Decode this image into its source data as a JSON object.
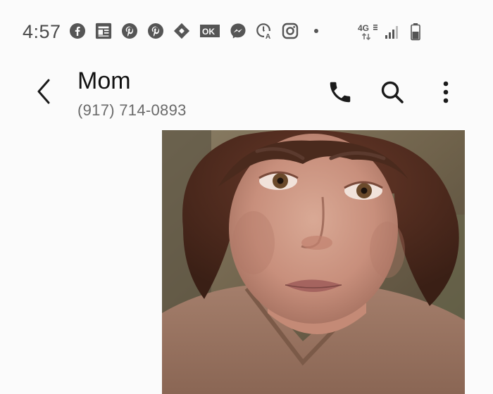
{
  "status_bar": {
    "time": "4:57",
    "network": "4G",
    "notification_icons": [
      "facebook-icon",
      "news-icon",
      "pinterest-icon",
      "pinterest-icon",
      "photos-icon",
      "ok-icon",
      "messenger-icon",
      "clock-a-icon",
      "instagram-icon",
      "more-dot-icon"
    ],
    "system_icons": [
      "network-4g-icon",
      "signal-icon",
      "battery-icon"
    ]
  },
  "header": {
    "contact_name": "Mom",
    "contact_number": "(917) 714-0893",
    "actions": [
      "phone-icon",
      "search-icon",
      "more-vert-icon"
    ]
  },
  "message": {
    "type": "photo",
    "photo_subject": "selfie"
  },
  "colors": {
    "background": "#fbfbfb",
    "text_primary": "#111111",
    "text_secondary": "#6a6a6a",
    "icon": "#1a1a1a"
  }
}
